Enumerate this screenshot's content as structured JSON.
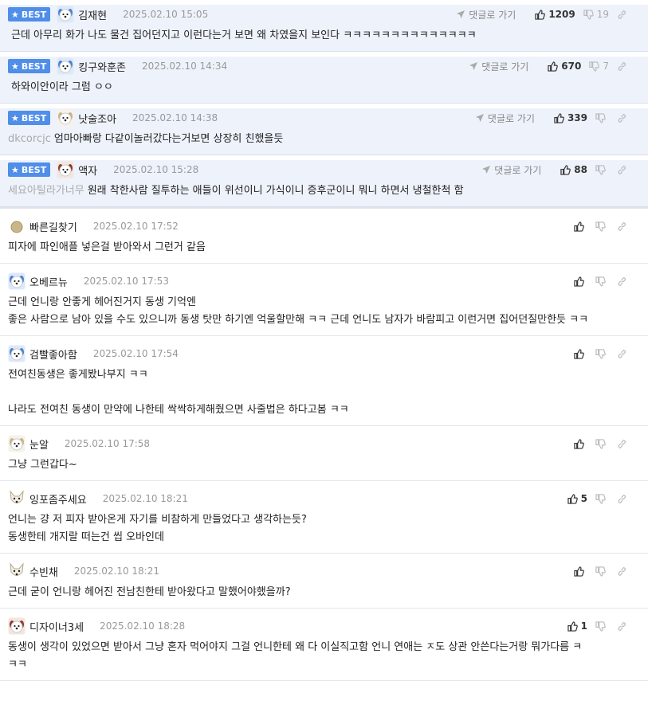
{
  "labels": {
    "best": "BEST",
    "reply": "댓글로 가기"
  },
  "colors": {
    "best_bg": "#eef2fb",
    "badge": "#4f8ee9"
  },
  "best_comments": [
    {
      "avatar": "blue-dog",
      "nick": "김재현",
      "date": "2025.02.10 15:05",
      "likes": "1209",
      "dislikes": "19",
      "prefix": "",
      "text": "근데 아무리 화가 나도 물건 집어던지고 이런다는거 보면 왜 차였을지 보인다 ㅋㅋㅋㅋㅋㅋㅋㅋㅋㅋㅋㅋㅋㅋ"
    },
    {
      "avatar": "blue-dog",
      "nick": "킹구와훈존",
      "date": "2025.02.10 14:34",
      "likes": "670",
      "dislikes": "7",
      "prefix": "",
      "text": "하와이안이라 그럼 ㅇㅇ"
    },
    {
      "avatar": "white-dog",
      "nick": "낫술조아",
      "date": "2025.02.10 14:38",
      "likes": "339",
      "dislikes": "",
      "prefix": "dkcorcjc",
      "text": "엄마아빠랑 다같이놀러갔다는거보면 상장히 친했을듯"
    },
    {
      "avatar": "brown-dog",
      "nick": "액자",
      "date": "2025.02.10 15:28",
      "likes": "88",
      "dislikes": "",
      "prefix": "세요아틸라가너무",
      "text": "원래 착한사람 질투하는 애들이 위선이니 가식이니 증후군이니 뭐니 하면서 냉철한척 함"
    }
  ],
  "comments": [
    {
      "avatar": "dot",
      "nick": "빠른길찾기",
      "date": "2025.02.10 17:52",
      "likes": "",
      "text": "피자에 파인애플 넣은걸 받아와서 그런거 같음"
    },
    {
      "avatar": "blue-dog",
      "nick": "오베르뉴",
      "date": "2025.02.10 17:53",
      "likes": "",
      "text": "근데 언니랑 안좋게 헤어진거지 동생 기억엔\n좋은 사람으로 남아 있을 수도 있으니까 동생 탓만 하기엔 억울할만해 ㅋㅋ 근데 언니도 남자가 바람피고 이런거면 집어던질만한듯 ㅋㅋ"
    },
    {
      "avatar": "blue-dog",
      "nick": "검빨좋아함",
      "date": "2025.02.10 17:54",
      "likes": "",
      "text": "전여친동생은 좋게봤나부지 ㅋㅋ\n\n나라도 전여친 동생이 만약에 나한테 싹싹하게해줬으면 사줄법은 하다고봄 ㅋㅋ"
    },
    {
      "avatar": "white-dog",
      "nick": "눈알",
      "date": "2025.02.10 17:58",
      "likes": "",
      "text": "그냥 그런갑다~"
    },
    {
      "avatar": "fox",
      "nick": "잉포좀주세요",
      "date": "2025.02.10 18:21",
      "likes": "5",
      "text": "언니는 걍 저 피자 받아온게 자기를 비참하게 만들었다고 생각하는듯?\n동생한테 개지랄 떠는건 씹 오바인데"
    },
    {
      "avatar": "fox",
      "nick": "수빈채",
      "date": "2025.02.10 18:21",
      "likes": "",
      "text": "근데 굳이 언니랑 헤어진 전남친한테 받아왔다고 말했어야했을까?"
    },
    {
      "avatar": "brown-dog",
      "nick": "디자이너3세",
      "date": "2025.02.10 18:28",
      "likes": "1",
      "text": "동생이 생각이 있었으면 받아서 그냥 혼자 먹어야지 그걸 언니한테 왜 다 이실직고함 언니 연애는 ㅈ도 상관 안쓴다는거랑 뭐가다름 ㅋ\nㅋㅋ"
    }
  ]
}
